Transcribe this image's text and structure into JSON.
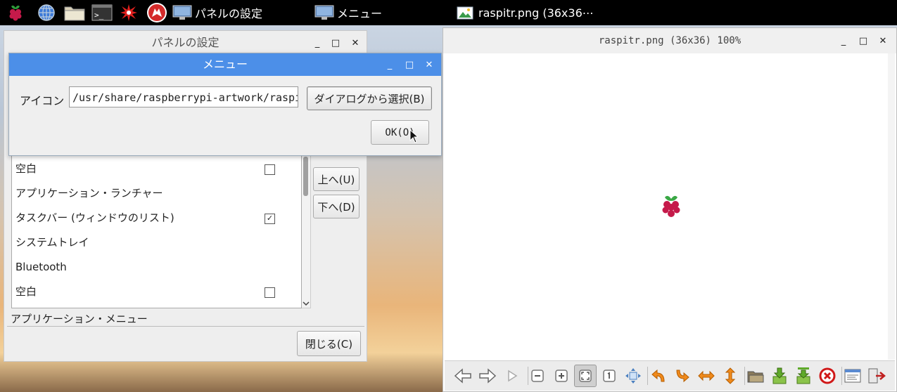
{
  "taskbar": {
    "launchers": [
      "raspberry-menu-icon",
      "web-browser-icon",
      "file-manager-icon",
      "terminal-icon",
      "burst-app-icon",
      "wolfram-icon"
    ],
    "tasks": [
      {
        "label": "パネルの設定"
      },
      {
        "label": "メニュー"
      },
      {
        "label": "raspitr.png (36x36⋯"
      }
    ]
  },
  "panel_window": {
    "title": "パネルの設定",
    "items": [
      {
        "label": "空白",
        "checkbox": "unchecked"
      },
      {
        "label": "アプリケーション・ランチャー",
        "checkbox": null
      },
      {
        "label": "タスクバー (ウィンドウのリスト)",
        "checkbox": "checked"
      },
      {
        "label": "システムトレイ",
        "checkbox": null
      },
      {
        "label": "Bluetooth",
        "checkbox": null
      },
      {
        "label": "空白",
        "checkbox": "unchecked"
      }
    ],
    "buttons": {
      "up": "上へ(U)",
      "down": "下へ(D)",
      "close": "閉じる(C)"
    },
    "selected_plugin_label": "アプリケーション・メニュー",
    "check_mark": "✓"
  },
  "menu_dialog": {
    "title": "メニュー",
    "icon_label": "アイコン",
    "icon_path": "/usr/share/raspberrypi-artwork/raspitr.png",
    "pick_button": "ダイアログから選択(B)",
    "ok_button": "OK(O)"
  },
  "viewer": {
    "title": "raspitr.png (36x36) 100%",
    "tools": [
      "back-icon",
      "forward-icon",
      "play-icon",
      "zoom-out-icon",
      "zoom-in-icon",
      "zoom-fit-icon",
      "zoom-original-icon",
      "fullscreen-icon",
      "rotate-left-icon",
      "rotate-right-icon",
      "flip-horizontal-icon",
      "flip-vertical-icon",
      "open-file-icon",
      "save-icon",
      "save-as-icon",
      "delete-icon",
      "preferences-icon",
      "quit-icon"
    ]
  },
  "window_controls": {
    "minimize": "_",
    "maximize": "□",
    "close": "✕"
  },
  "colors": {
    "accent_titlebar": "#4c8fe8",
    "taskbar": "#000000"
  }
}
